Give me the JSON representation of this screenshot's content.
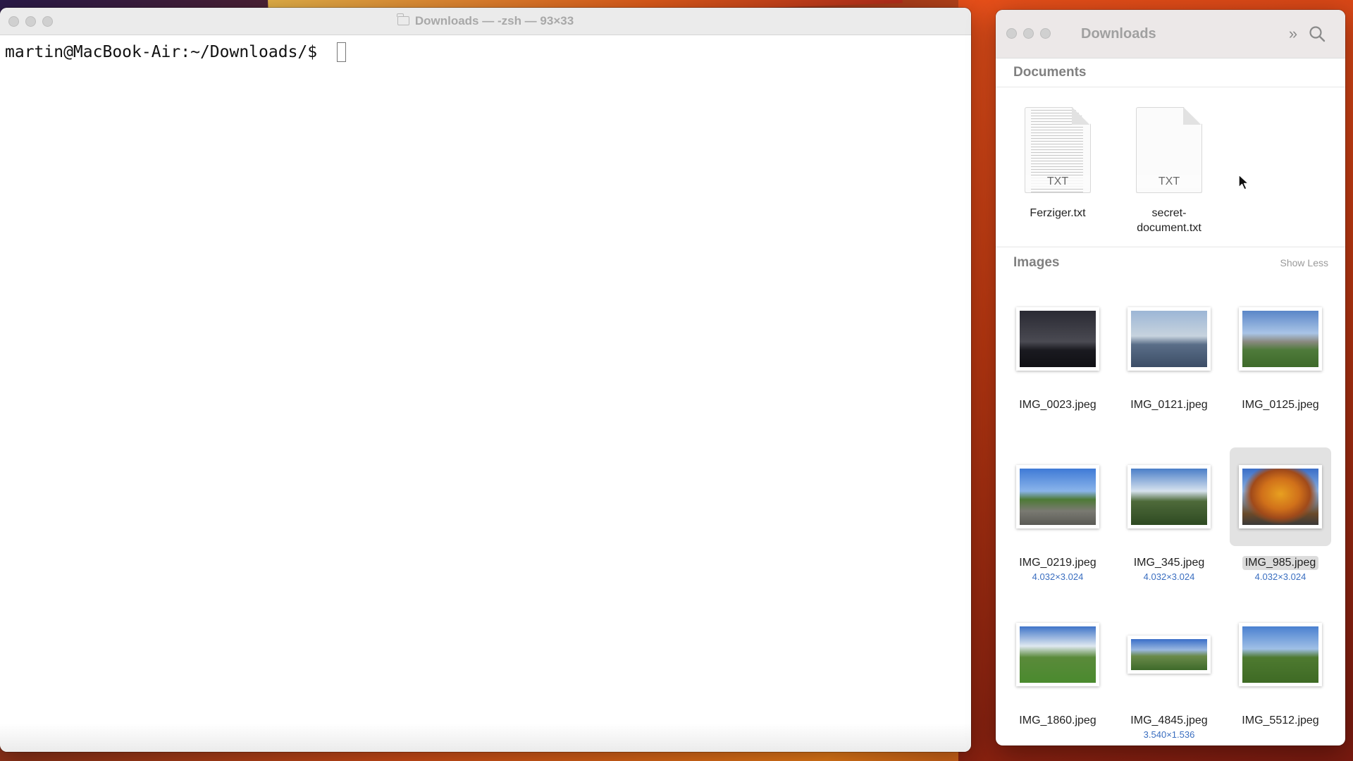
{
  "terminal": {
    "title": "Downloads — -zsh — 93×33",
    "prompt": "martin@MacBook-Air:~/Downloads/$ "
  },
  "finder": {
    "title": "Downloads",
    "documents_section": "Documents",
    "documents": [
      {
        "name": "Ferziger.txt",
        "ext": "TXT"
      },
      {
        "name": "secret-\ndocument.txt",
        "ext": "TXT"
      }
    ],
    "images_section": "Images",
    "show_less": "Show Less",
    "images": [
      {
        "name": "IMG_0023.jpeg",
        "dims": ""
      },
      {
        "name": "IMG_0121.jpeg",
        "dims": ""
      },
      {
        "name": "IMG_0125.jpeg",
        "dims": ""
      },
      {
        "name": "IMG_0219.jpeg",
        "dims": "4.032×3.024"
      },
      {
        "name": "IMG_345.jpeg",
        "dims": "4.032×3.024"
      },
      {
        "name": "IMG_985.jpeg",
        "dims": "4.032×3.024",
        "selected": true
      },
      {
        "name": "IMG_1860.jpeg",
        "dims": ""
      },
      {
        "name": "IMG_4845.jpeg",
        "dims": "3.540×1.536"
      },
      {
        "name": "IMG_5512.jpeg",
        "dims": ""
      }
    ]
  },
  "icons": {
    "terminal_title_icon": "folder-icon",
    "overflow_icon": "chevron-double-right-icon",
    "search_icon": "search-icon"
  },
  "colors": {
    "selection_bg": "#dcdcdc",
    "dimension_text": "#3a6ec0"
  }
}
